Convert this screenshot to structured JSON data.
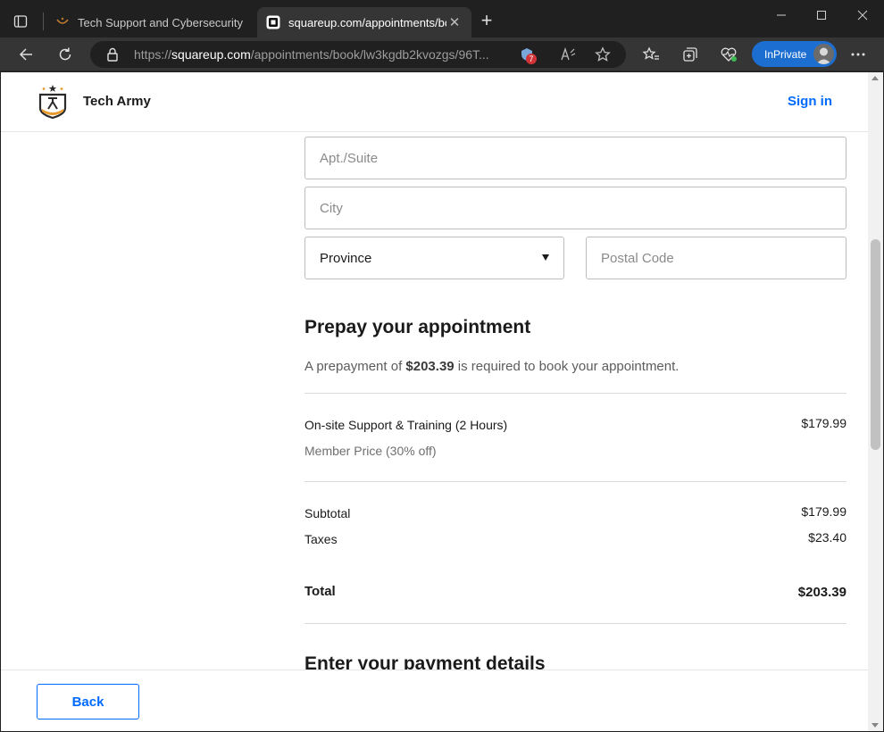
{
  "browser": {
    "tabs": [
      {
        "title": "Tech Support and Cybersecurity"
      },
      {
        "title": "squareup.com/appointments/book/"
      }
    ],
    "address": {
      "prefix": "https://",
      "domain": "squareup.com",
      "path": "/appointments/book/lw3kgdb2kvozgs/96T..."
    },
    "tracking_badge_count": "7",
    "inprivate_label": "InPrivate"
  },
  "site": {
    "brand": "Tech Army",
    "signin": "Sign in"
  },
  "address_form": {
    "apt_placeholder": "Apt./Suite",
    "city_placeholder": "City",
    "province_selected": "Province",
    "postal_placeholder": "Postal Code"
  },
  "prepay": {
    "heading": "Prepay your appointment",
    "note_prefix": "A prepayment of ",
    "note_amount": "$203.39",
    "note_suffix": " is required to book your appointment.",
    "item": {
      "name": "On-site Support & Training (2 Hours)",
      "sub": "Member Price (30% off)",
      "price": "$179.99"
    },
    "subtotal_label": "Subtotal",
    "subtotal": "$179.99",
    "taxes_label": "Taxes",
    "taxes": "$23.40",
    "total_label": "Total",
    "total": "$203.39"
  },
  "payment": {
    "heading": "Enter your payment details"
  },
  "footer": {
    "back_label": "Back"
  },
  "colors": {
    "accent": "#006aff",
    "inprivate": "#1c6fd1"
  }
}
